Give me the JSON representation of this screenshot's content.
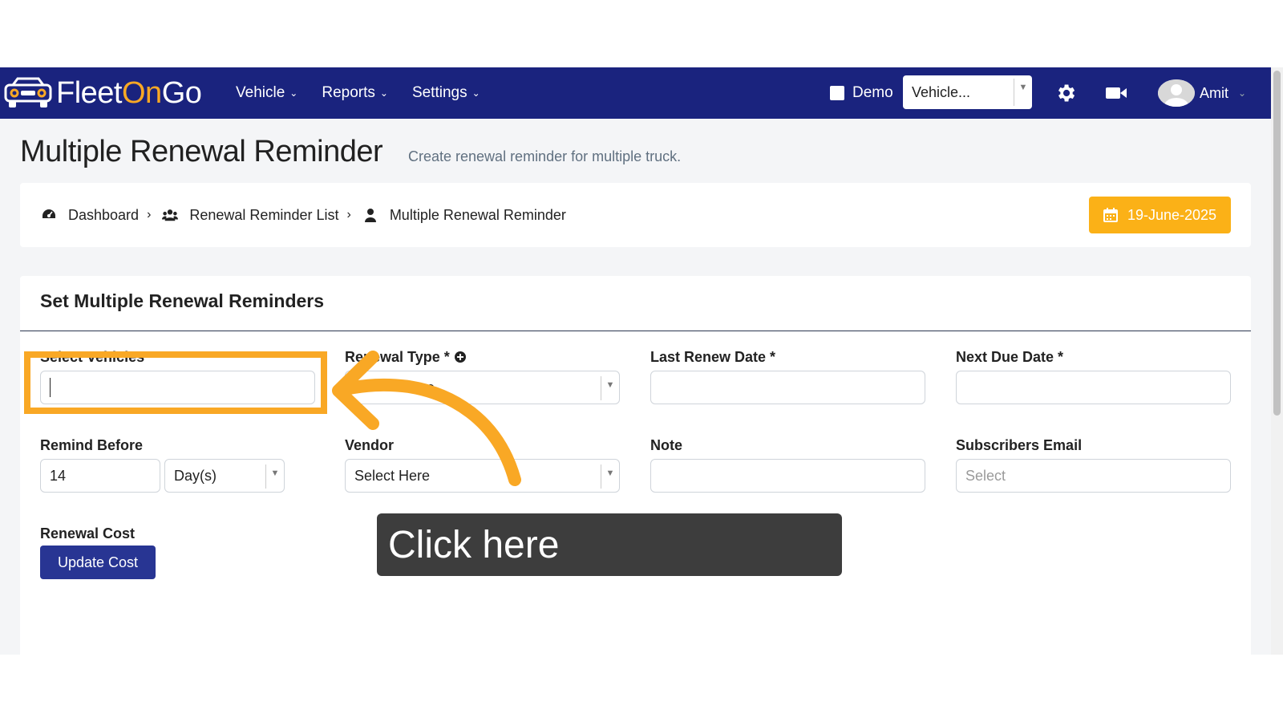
{
  "brand": {
    "name_fleet": "Fleet",
    "name_on": "On",
    "name_go": "Go",
    "colors": {
      "navbar": "#1a237e",
      "accent": "#f9a825",
      "primary_button": "#283593",
      "date_button": "#fbb117"
    }
  },
  "navbar": {
    "menu": [
      {
        "label": "Vehicle",
        "icon": "chevron-down-icon"
      },
      {
        "label": "Reports",
        "icon": "chevron-down-icon"
      },
      {
        "label": "Settings",
        "icon": "chevron-down-icon"
      }
    ],
    "demo_label": "Demo",
    "vehicle_select_value": "Vehicle...",
    "settings_icon": "gear-icon",
    "video_icon": "video-camera-icon",
    "user_name": "Amit"
  },
  "page": {
    "title": "Multiple Renewal Reminder",
    "subtitle": "Create renewal reminder for multiple truck."
  },
  "breadcrumb": {
    "items": [
      {
        "label": "Dashboard",
        "icon": "dashboard-icon"
      },
      {
        "label": "Renewal Reminder List",
        "icon": "users-icon"
      },
      {
        "label": "Multiple Renewal Reminder",
        "icon": "user-icon"
      }
    ],
    "separator": "›",
    "date": "19-June-2025"
  },
  "form": {
    "title": "Set Multiple Renewal Reminders",
    "select_vehicles_label": "Select Vehicles *",
    "renewal_type_label": "Renewal Type *",
    "renewal_type_partial_value": "e",
    "last_renew_date_label": "Last Renew Date *",
    "next_due_date_label": "Next Due Date *",
    "remind_before_label": "Remind Before",
    "remind_before_value": "14",
    "remind_before_unit": "Day(s)",
    "vendor_label": "Vendor",
    "vendor_value": "Select Here",
    "note_label": "Note",
    "subscribers_email_label": "Subscribers Email",
    "subscribers_email_placeholder": "Select",
    "renewal_cost_label": "Renewal Cost",
    "update_cost_button": "Update Cost"
  },
  "overlay": {
    "tooltip_text": "Click here"
  }
}
